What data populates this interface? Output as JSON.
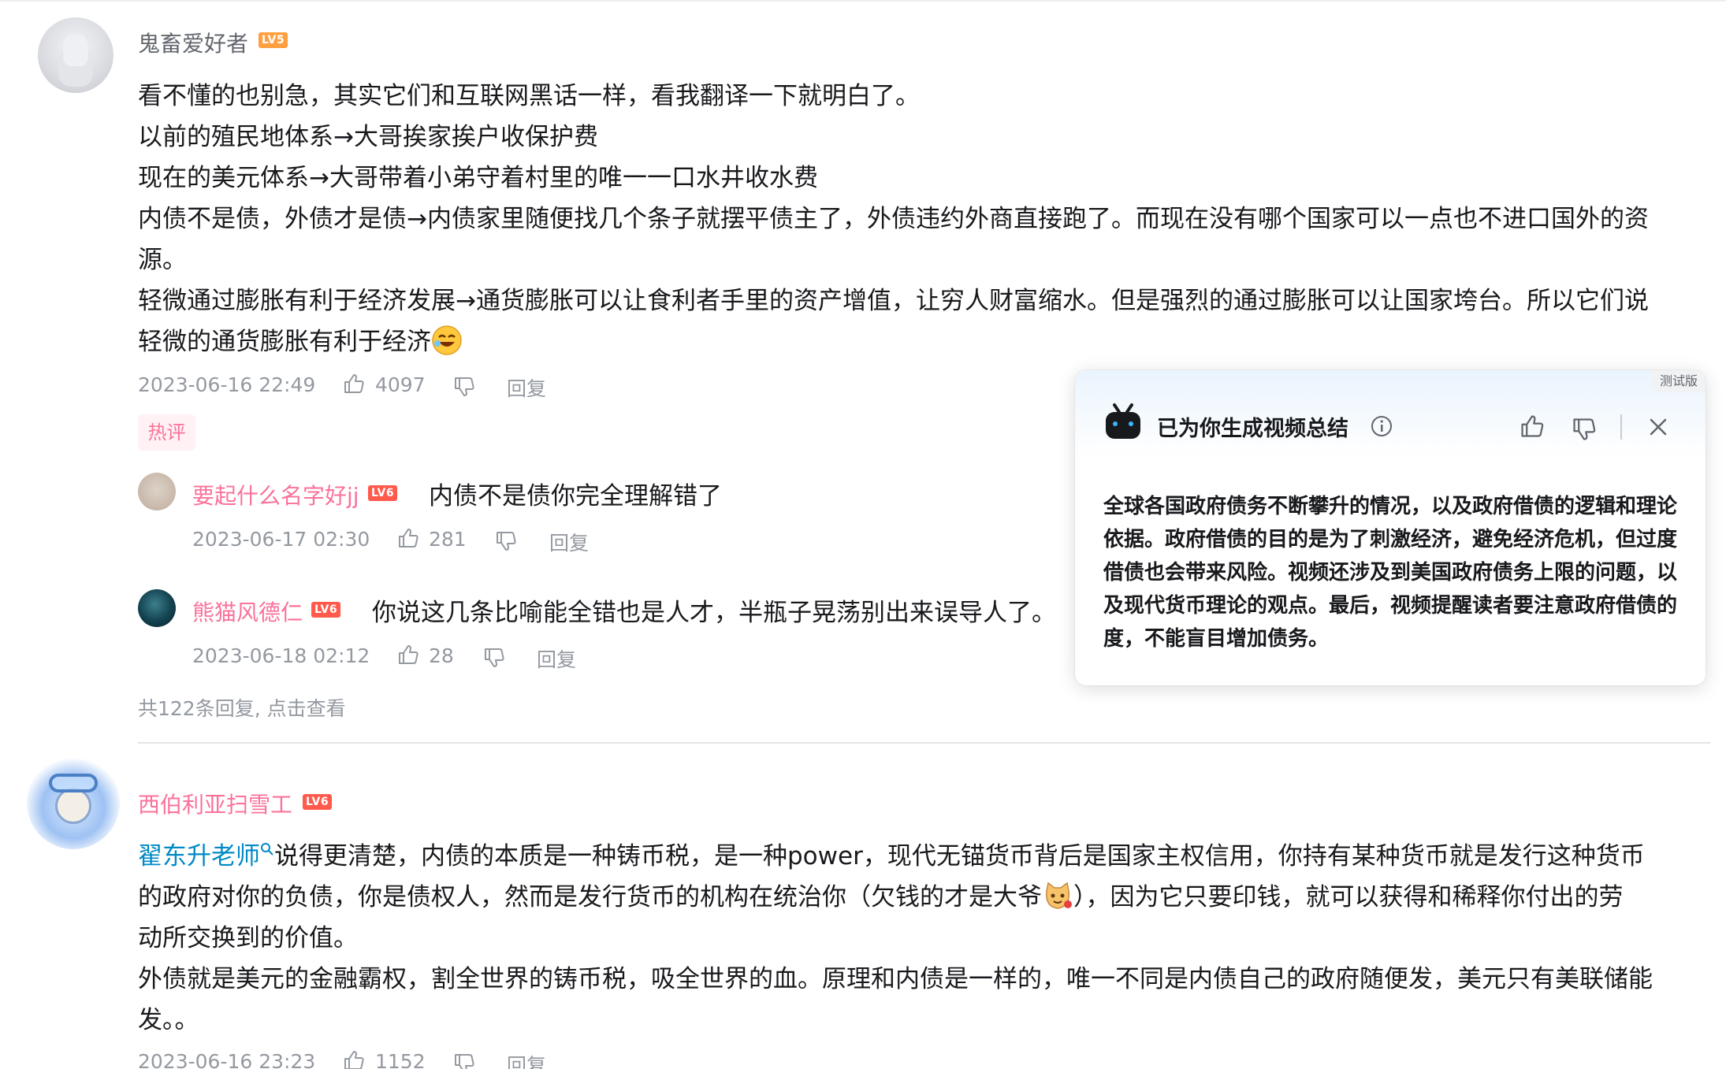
{
  "comment1": {
    "username": "鬼畜爱好者",
    "level": "LV5",
    "lines": [
      "看不懂的也别急，其实它们和互联网黑话一样，看我翻译一下就明白了。",
      "以前的殖民地体系→大哥挨家挨户收保护费",
      "现在的美元体系→大哥带着小弟守着村里的唯一一口水井收水费",
      "内债不是债，外债才是债→内债家里随便找几个条子就摆平债主了，外债违约外商直接跑了。而现在没有哪个国家可以一点也不进口国外的资",
      "源。",
      "轻微通过膨胀有利于经济发展→通货膨胀可以让食利者手里的资产增值，让穷人财富缩水。但是强烈的通过膨胀可以让国家垮台。所以它们说",
      "轻微的通货膨胀有利于经济"
    ],
    "date": "2023-06-16 22:49",
    "likes": "4097",
    "reply_label": "回复",
    "hot_tag": "热评"
  },
  "replies": [
    {
      "username": "要起什么名字好jj",
      "level": "LV6",
      "text": "内债不是债你完全理解错了",
      "date": "2023-06-17 02:30",
      "likes": "281",
      "reply_label": "回复"
    },
    {
      "username": "熊猫风德仁",
      "level": "LV6",
      "text": "你说这几条比喻能全错也是人才，半瓶子晃荡别出来误导人了。",
      "date": "2023-06-18 02:12",
      "likes": "28",
      "reply_label": "回复"
    }
  ],
  "view_more": "共122条回复, 点击查看",
  "comment2": {
    "username": "西伯利亚扫雪工",
    "level": "LV6",
    "mention": "翟东升老师",
    "line1_rest": "说得更清楚，内债的本质是一种铸币税，是一种power，现代无锚货币背后是国家主权信用，你持有某种货币就是发行这种货币",
    "line2a": "的政府对你的负债，你是债权人，然而是发行货币的机构在统治你（欠钱的才是大爷",
    "line2b": "），因为它只要印钱，就可以获得和稀释你付出的劳",
    "line3": "动所交换到的价值。",
    "line4": "外债就是美元的金融霸权，割全世界的铸币税，吸全世界的血。原理和内债是一样的，唯一不同是内债自己的政府随便发，美元只有美联储能",
    "line5": "发。。",
    "date": "2023-06-16 23:23",
    "likes": "1152",
    "reply_label": "回复"
  },
  "ai_summary": {
    "badge": "测试版",
    "title": "已为你生成视频总结",
    "body": "全球各国政府债务不断攀升的情况，以及政府借债的逻辑和理论依据。政府借债的目的是为了刺激经济，避免经济危机，但过度借债也会带来风险。视频还涉及到美国政府债务上限的问题，以及现代货币理论的观点。最后，视频提醒读者要注意政府借债的度，不能盲目增加债务。"
  },
  "colors": {
    "username_pink": "#fb7299",
    "meta_gray": "#9499a0",
    "link_blue": "#008ac5",
    "lv5": "#ff9f3f",
    "lv6": "#ff5a4c"
  }
}
